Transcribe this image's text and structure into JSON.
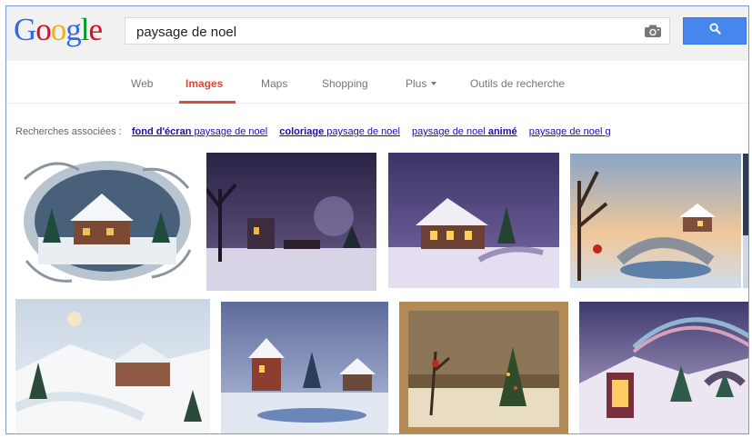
{
  "logo": {
    "letters": [
      "G",
      "o",
      "o",
      "g",
      "l",
      "e"
    ]
  },
  "search": {
    "query": "paysage de noel"
  },
  "icons": {
    "camera": "camera-icon",
    "search": "search-icon"
  },
  "nav": {
    "tabs": [
      {
        "label": "Web"
      },
      {
        "label": "Images"
      },
      {
        "label": "Maps"
      },
      {
        "label": "Shopping"
      },
      {
        "label": "Plus"
      },
      {
        "label": "Outils de recherche"
      }
    ]
  },
  "related": {
    "label": "Recherches associées :",
    "items": [
      {
        "bold": "fond d'écran",
        "rest": " paysage de noel"
      },
      {
        "bold": "coloriage",
        "rest": " paysage de noel"
      },
      {
        "pre": "paysage de noel ",
        "bold": "animé"
      },
      {
        "pre": "paysage de noel g"
      }
    ]
  },
  "colors": {
    "accent": "#dd4b39",
    "search_button": "#4787ed",
    "link": "#1a0dab",
    "logo": [
      "#3369e8",
      "#d50f25",
      "#eeb211",
      "#3369e8",
      "#009925",
      "#d50f25"
    ]
  }
}
